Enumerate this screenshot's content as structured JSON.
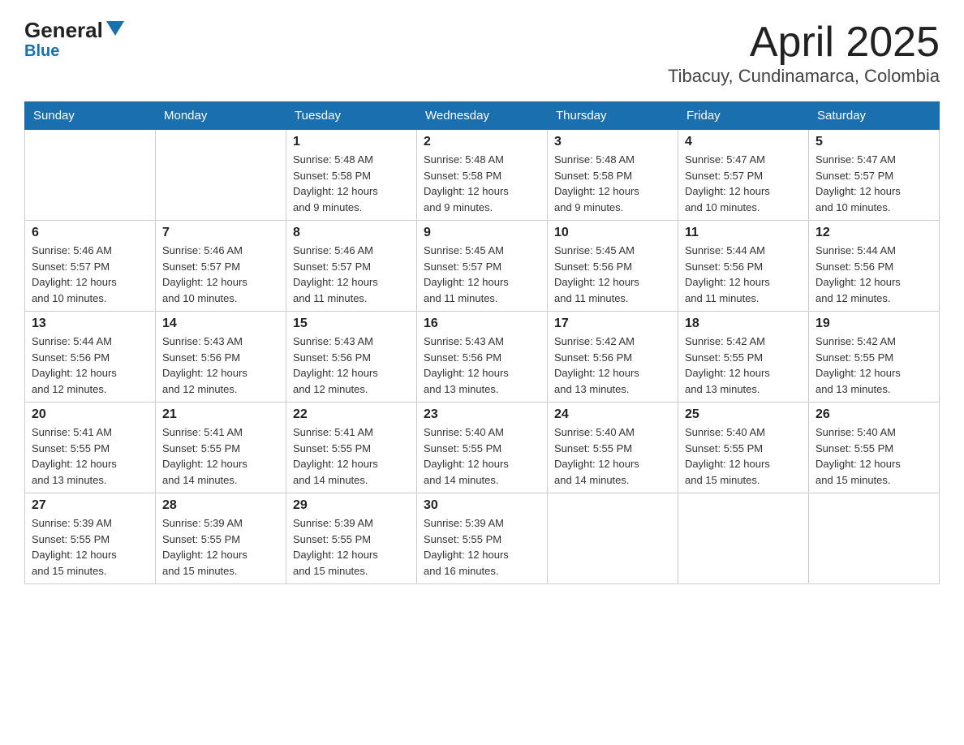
{
  "logo": {
    "brand": "General",
    "accent": "Blue"
  },
  "header": {
    "title": "April 2025",
    "subtitle": "Tibacuy, Cundinamarca, Colombia"
  },
  "weekdays": [
    "Sunday",
    "Monday",
    "Tuesday",
    "Wednesday",
    "Thursday",
    "Friday",
    "Saturday"
  ],
  "weeks": [
    [
      {
        "day": "",
        "info": ""
      },
      {
        "day": "",
        "info": ""
      },
      {
        "day": "1",
        "info": "Sunrise: 5:48 AM\nSunset: 5:58 PM\nDaylight: 12 hours\nand 9 minutes."
      },
      {
        "day": "2",
        "info": "Sunrise: 5:48 AM\nSunset: 5:58 PM\nDaylight: 12 hours\nand 9 minutes."
      },
      {
        "day": "3",
        "info": "Sunrise: 5:48 AM\nSunset: 5:58 PM\nDaylight: 12 hours\nand 9 minutes."
      },
      {
        "day": "4",
        "info": "Sunrise: 5:47 AM\nSunset: 5:57 PM\nDaylight: 12 hours\nand 10 minutes."
      },
      {
        "day": "5",
        "info": "Sunrise: 5:47 AM\nSunset: 5:57 PM\nDaylight: 12 hours\nand 10 minutes."
      }
    ],
    [
      {
        "day": "6",
        "info": "Sunrise: 5:46 AM\nSunset: 5:57 PM\nDaylight: 12 hours\nand 10 minutes."
      },
      {
        "day": "7",
        "info": "Sunrise: 5:46 AM\nSunset: 5:57 PM\nDaylight: 12 hours\nand 10 minutes."
      },
      {
        "day": "8",
        "info": "Sunrise: 5:46 AM\nSunset: 5:57 PM\nDaylight: 12 hours\nand 11 minutes."
      },
      {
        "day": "9",
        "info": "Sunrise: 5:45 AM\nSunset: 5:57 PM\nDaylight: 12 hours\nand 11 minutes."
      },
      {
        "day": "10",
        "info": "Sunrise: 5:45 AM\nSunset: 5:56 PM\nDaylight: 12 hours\nand 11 minutes."
      },
      {
        "day": "11",
        "info": "Sunrise: 5:44 AM\nSunset: 5:56 PM\nDaylight: 12 hours\nand 11 minutes."
      },
      {
        "day": "12",
        "info": "Sunrise: 5:44 AM\nSunset: 5:56 PM\nDaylight: 12 hours\nand 12 minutes."
      }
    ],
    [
      {
        "day": "13",
        "info": "Sunrise: 5:44 AM\nSunset: 5:56 PM\nDaylight: 12 hours\nand 12 minutes."
      },
      {
        "day": "14",
        "info": "Sunrise: 5:43 AM\nSunset: 5:56 PM\nDaylight: 12 hours\nand 12 minutes."
      },
      {
        "day": "15",
        "info": "Sunrise: 5:43 AM\nSunset: 5:56 PM\nDaylight: 12 hours\nand 12 minutes."
      },
      {
        "day": "16",
        "info": "Sunrise: 5:43 AM\nSunset: 5:56 PM\nDaylight: 12 hours\nand 13 minutes."
      },
      {
        "day": "17",
        "info": "Sunrise: 5:42 AM\nSunset: 5:56 PM\nDaylight: 12 hours\nand 13 minutes."
      },
      {
        "day": "18",
        "info": "Sunrise: 5:42 AM\nSunset: 5:55 PM\nDaylight: 12 hours\nand 13 minutes."
      },
      {
        "day": "19",
        "info": "Sunrise: 5:42 AM\nSunset: 5:55 PM\nDaylight: 12 hours\nand 13 minutes."
      }
    ],
    [
      {
        "day": "20",
        "info": "Sunrise: 5:41 AM\nSunset: 5:55 PM\nDaylight: 12 hours\nand 13 minutes."
      },
      {
        "day": "21",
        "info": "Sunrise: 5:41 AM\nSunset: 5:55 PM\nDaylight: 12 hours\nand 14 minutes."
      },
      {
        "day": "22",
        "info": "Sunrise: 5:41 AM\nSunset: 5:55 PM\nDaylight: 12 hours\nand 14 minutes."
      },
      {
        "day": "23",
        "info": "Sunrise: 5:40 AM\nSunset: 5:55 PM\nDaylight: 12 hours\nand 14 minutes."
      },
      {
        "day": "24",
        "info": "Sunrise: 5:40 AM\nSunset: 5:55 PM\nDaylight: 12 hours\nand 14 minutes."
      },
      {
        "day": "25",
        "info": "Sunrise: 5:40 AM\nSunset: 5:55 PM\nDaylight: 12 hours\nand 15 minutes."
      },
      {
        "day": "26",
        "info": "Sunrise: 5:40 AM\nSunset: 5:55 PM\nDaylight: 12 hours\nand 15 minutes."
      }
    ],
    [
      {
        "day": "27",
        "info": "Sunrise: 5:39 AM\nSunset: 5:55 PM\nDaylight: 12 hours\nand 15 minutes."
      },
      {
        "day": "28",
        "info": "Sunrise: 5:39 AM\nSunset: 5:55 PM\nDaylight: 12 hours\nand 15 minutes."
      },
      {
        "day": "29",
        "info": "Sunrise: 5:39 AM\nSunset: 5:55 PM\nDaylight: 12 hours\nand 15 minutes."
      },
      {
        "day": "30",
        "info": "Sunrise: 5:39 AM\nSunset: 5:55 PM\nDaylight: 12 hours\nand 16 minutes."
      },
      {
        "day": "",
        "info": ""
      },
      {
        "day": "",
        "info": ""
      },
      {
        "day": "",
        "info": ""
      }
    ]
  ]
}
